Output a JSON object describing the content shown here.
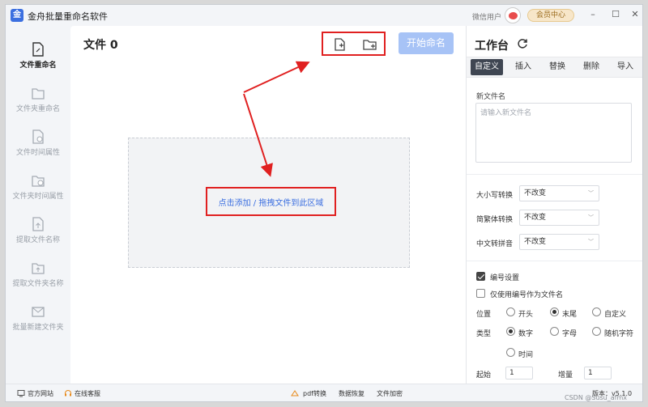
{
  "app": {
    "logo_text": "金",
    "title": "金舟批量重命名软件"
  },
  "titlebar": {
    "wechat_user": "微信用户",
    "member_center": "会员中心",
    "minimize": "–",
    "maximize": "☐",
    "close": "✕"
  },
  "sidebar": {
    "items": [
      {
        "label": "文件重命名",
        "active": true
      },
      {
        "label": "文件夹重命名"
      },
      {
        "label": "文件时间属性"
      },
      {
        "label": "文件夹时间属性"
      },
      {
        "label": "提取文件名称"
      },
      {
        "label": "提取文件夹名称"
      },
      {
        "label": "批量新建文件夹"
      }
    ]
  },
  "main": {
    "file_count_label": "文件 0",
    "start_button": "开始命名",
    "drop_label": "点击添加 / 拖拽文件到此区域"
  },
  "workspace": {
    "title": "工作台",
    "tabs": [
      "自定义",
      "插入",
      "替换",
      "删除",
      "导入"
    ],
    "new_name_label": "新文件名",
    "new_name_placeholder": "请输入新文件名",
    "case_label": "大小写转换",
    "case_value": "不改变",
    "trad_label": "简繁体转换",
    "trad_value": "不改变",
    "pinyin_label": "中文转拼音",
    "pinyin_value": "不改变",
    "numbering_label": "编号设置",
    "only_number_label": "仅使用编号作为文件名",
    "position_label": "位置",
    "position_options": [
      "开头",
      "末尾",
      "自定义"
    ],
    "type_label": "类型",
    "type_options": [
      "数字",
      "字母",
      "随机字符",
      "时间"
    ],
    "start_label": "起始",
    "start_value": "1",
    "step_label": "增量",
    "step_value": "1"
  },
  "footer": {
    "website": "官方网站",
    "support": "在线客服",
    "pdf": "pdf转换",
    "recovery": "数据恢复",
    "encrypt": "文件加密",
    "version": "版本：v5.1.0"
  },
  "watermark": "CSDN @Susu_afmx",
  "colors": {
    "accent": "#3a6ee0",
    "highlight_red": "#e02020",
    "start_button_disabled": "#a7c3f6",
    "tab_active": "#3f4652"
  }
}
